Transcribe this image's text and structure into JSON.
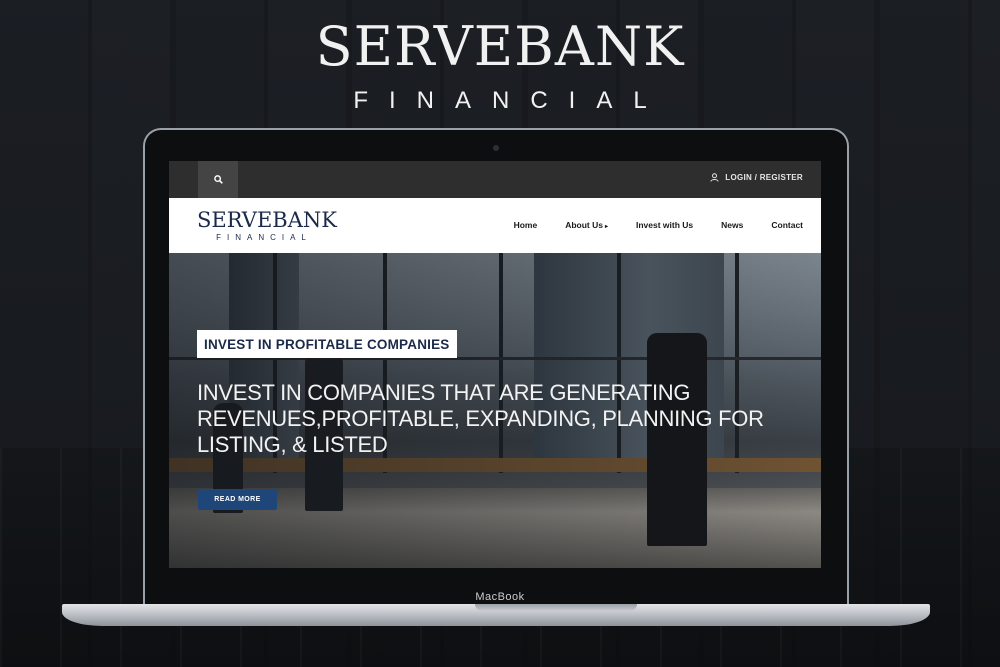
{
  "brand": {
    "name": "SERVEBANK",
    "sub": "FINANCIAL"
  },
  "device": {
    "label": "MacBook"
  },
  "topbar": {
    "search_icon": "search-icon",
    "login_icon": "user-icon",
    "login_label": "LOGIN / REGISTER"
  },
  "navbar": {
    "logo_name": "SERVEBANK",
    "logo_sub": "FINANCIAL",
    "items": [
      {
        "label": "Home"
      },
      {
        "label": "About Us"
      },
      {
        "label": "Invest with Us"
      },
      {
        "label": "News"
      },
      {
        "label": "Contact"
      }
    ],
    "about_caret": "▸"
  },
  "hero": {
    "badge": "INVEST IN PROFITABLE COMPANIES",
    "headline": "INVEST IN COMPANIES THAT ARE GENERATING REVENUES,PROFITABLE, EXPANDING, PLANNING FOR LISTING, & LISTED",
    "button": "READ MORE"
  },
  "colors": {
    "accent": "#1e4678",
    "navy": "#1b2a4a",
    "topbar": "#2e2e2e"
  }
}
